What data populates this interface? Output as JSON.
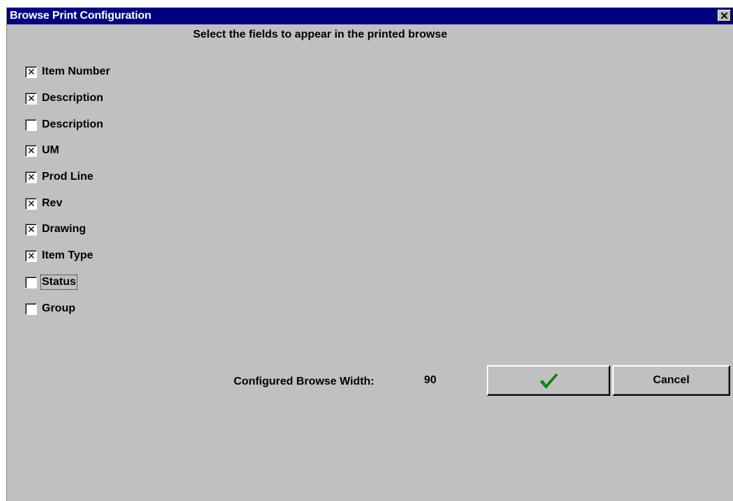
{
  "window": {
    "title": "Browse Print Configuration",
    "title_bar_color": "#000080",
    "close_icon": "close-icon"
  },
  "instruction": "Select the fields to appear in the printed browse",
  "fields": [
    {
      "label": "Item Number",
      "checked": true
    },
    {
      "label": "Description",
      "checked": true
    },
    {
      "label": "Description",
      "checked": false
    },
    {
      "label": "UM",
      "checked": true
    },
    {
      "label": "Prod Line",
      "checked": true
    },
    {
      "label": "Rev",
      "checked": true
    },
    {
      "label": "Drawing",
      "checked": true
    },
    {
      "label": "Item Type",
      "checked": true
    },
    {
      "label": "Status",
      "checked": false,
      "focused": true
    },
    {
      "label": "Group",
      "checked": false
    }
  ],
  "width_info": {
    "label": "Configured Browse Width:",
    "value": "90"
  },
  "buttons": {
    "ok_icon": "green-checkmark-icon",
    "ok_icon_color": "#00a000",
    "cancel_label": "Cancel"
  },
  "colors": {
    "dialog_background": "#c0c0c0"
  }
}
